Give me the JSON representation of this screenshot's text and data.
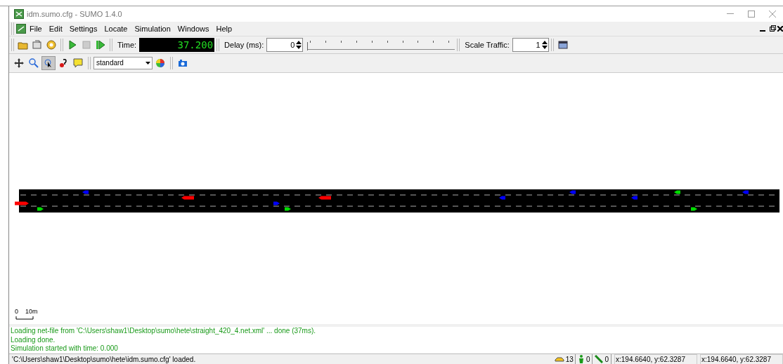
{
  "window": {
    "title": "idm.sumo.cfg - SUMO 1.4.0"
  },
  "menu": [
    "File",
    "Edit",
    "Settings",
    "Locate",
    "Simulation",
    "Windows",
    "Help"
  ],
  "toolbar": {
    "time_label": "Time:",
    "time": "37.200",
    "delay_label": "Delay (ms):",
    "delay": "0",
    "delay_slider": {
      "level": 0
    },
    "scale_label": "Scale Traffic:",
    "scale": "1"
  },
  "view_toolbar": {
    "scheme": "standard",
    "locate_selected": true
  },
  "scale_bar": {
    "start": "0",
    "end": "10m"
  },
  "messages": [
    "Loading net-file from 'C:\\Users\\shaw1\\Desktop\\sumo\\hete\\straight_420_4.net.xml' ... done (37ms).",
    "Loading done.",
    "Simulation started with time: 0.000"
  ],
  "status_bar": {
    "message": "'C:\\Users\\shaw1\\Desktop\\sumo\\hete\\idm.sumo.cfg' loaded.",
    "vehicles": "13",
    "persons": "0",
    "containers": "0",
    "coords": [
      "x:194.6640, y:62.3287",
      "x:194.6640, y:62.3287"
    ]
  }
}
